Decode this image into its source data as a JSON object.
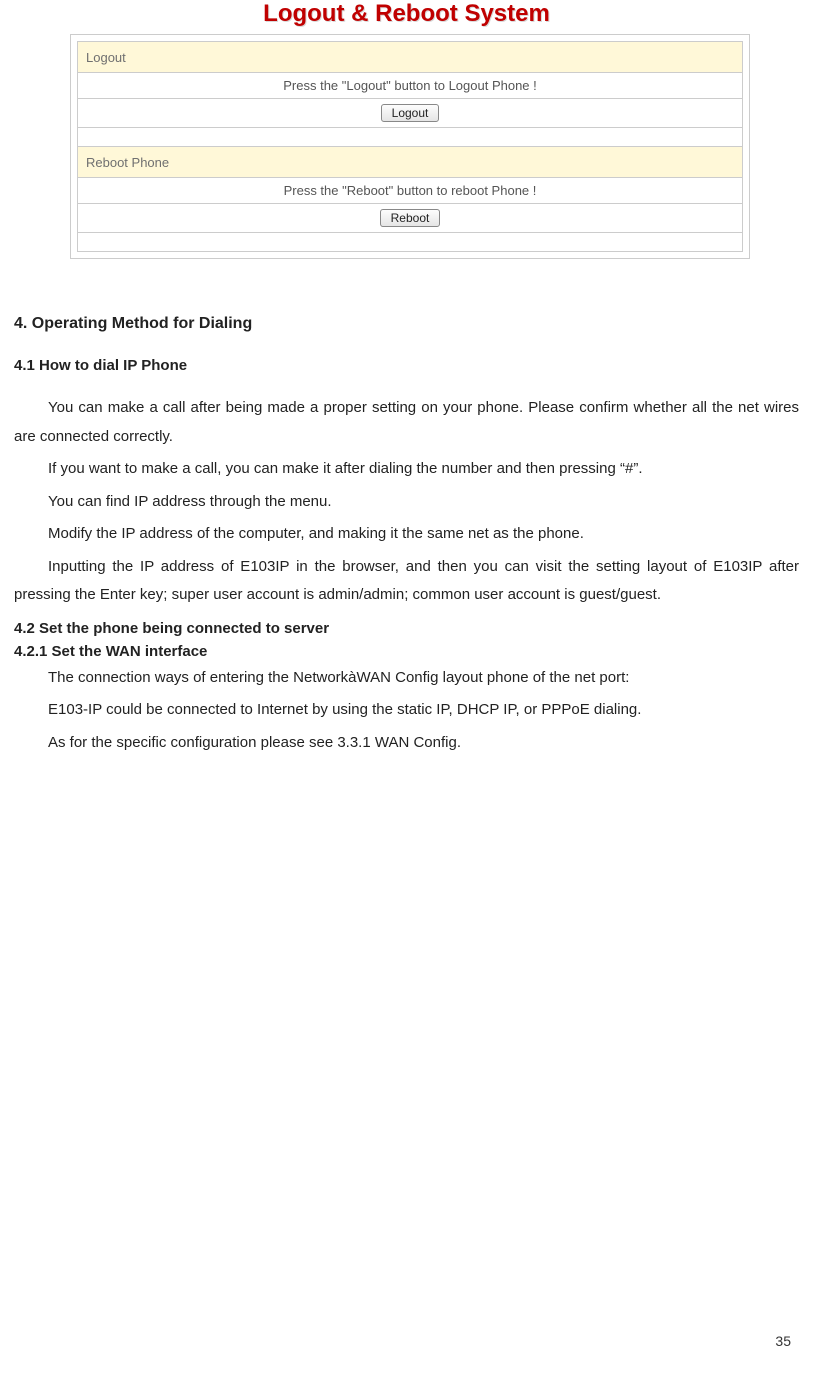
{
  "panel": {
    "title": "Logout & Reboot System",
    "logout": {
      "header": "Logout",
      "instruction": "Press the \"Logout\" button to Logout Phone !",
      "button": "Logout"
    },
    "reboot": {
      "header": "Reboot Phone",
      "instruction": "Press the \"Reboot\" button to reboot Phone !",
      "button": "Reboot"
    }
  },
  "doc": {
    "section4": "4. Operating Method for Dialing",
    "section41": "4.1 How to dial IP Phone",
    "p1": "You can make a call after being made a proper setting on your phone. Please confirm whether all the net wires are connected correctly.",
    "p2": "If you want to make a call, you can make it after dialing the number and then pressing “#”.",
    "p3": "You can find IP address through the menu.",
    "p4": "Modify the IP address of the computer, and making it the same net as the phone.",
    "p5": "Inputting the IP address of E103IP  in the browser, and then you can visit the setting layout of E103IP  after pressing the Enter key; super user account is admin/admin; common user account is guest/guest.",
    "section42": "4.2 Set the phone being connected to server",
    "section421": "4.2.1 Set the WAN interface",
    "p6": "The connection ways of entering the NetworkàWAN Config layout phone of the net port:",
    "p7": "E103-IP could be connected to Internet by using the static IP, DHCP IP, or PPPoE dialing.",
    "p8": "As for the specific configuration please see 3.3.1 WAN Config.",
    "pageNumber": "35"
  }
}
